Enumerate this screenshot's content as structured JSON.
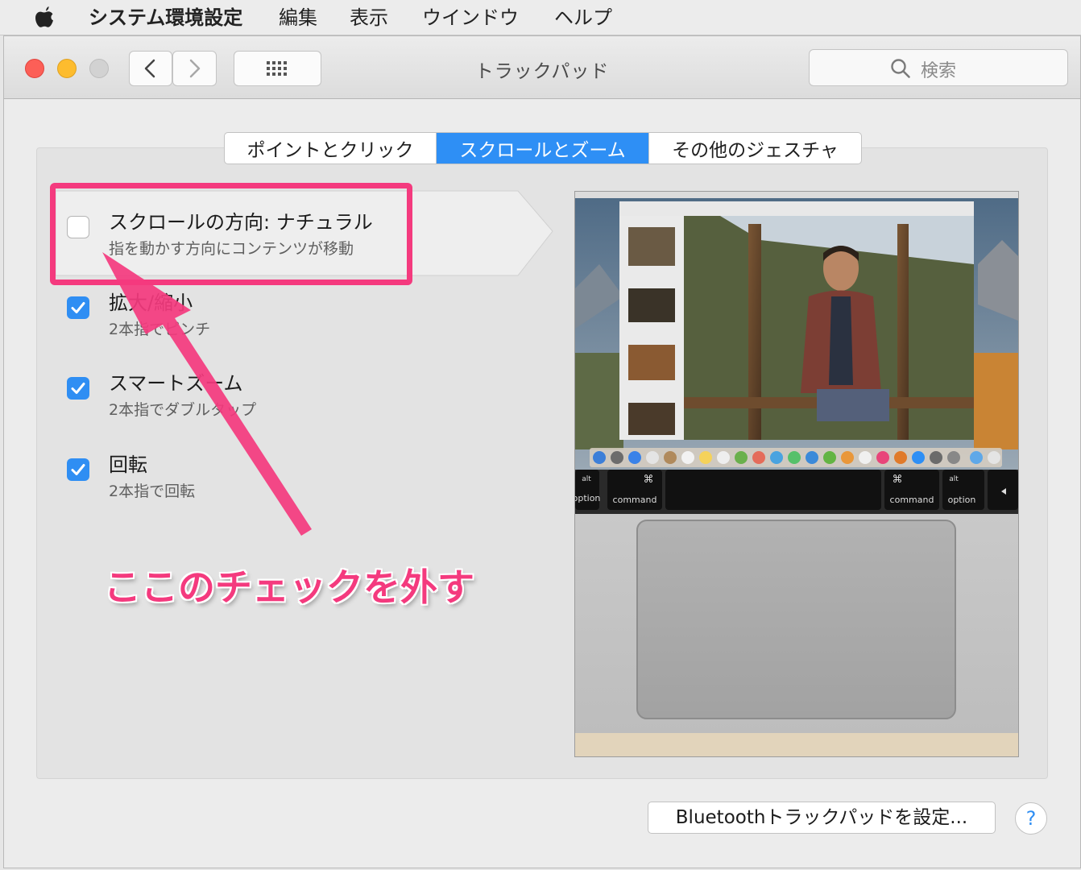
{
  "menubar": {
    "app_name": "システム環境設定",
    "items": [
      "編集",
      "表示",
      "ウインドウ",
      "ヘルプ"
    ]
  },
  "window": {
    "title": "トラックパッド",
    "search_placeholder": "検索"
  },
  "tabs": [
    {
      "label": "ポイントとクリック",
      "active": false
    },
    {
      "label": "スクロールとズーム",
      "active": true
    },
    {
      "label": "その他のジェスチャ",
      "active": false
    }
  ],
  "options": [
    {
      "title": "スクロールの方向: ナチュラル",
      "subtitle": "指を動かす方向にコンテンツが移動",
      "checked": false
    },
    {
      "title": "拡大/縮小",
      "subtitle": "2本指でピンチ",
      "checked": true
    },
    {
      "title": "スマートズーム",
      "subtitle": "2本指でダブルタップ",
      "checked": true
    },
    {
      "title": "回転",
      "subtitle": "2本指で回転",
      "checked": true
    }
  ],
  "preview": {
    "keys": [
      "option",
      "command",
      "command",
      "option"
    ],
    "key_alt": "alt",
    "key_cmd_symbol": "⌘"
  },
  "annotation": "ここのチェックを外す",
  "footer": {
    "bluetooth_button": "Bluetoothトラックパッドを設定...",
    "help_label": "?"
  },
  "colors": {
    "accent": "#2e8ff5",
    "annotation": "#f43a7e"
  }
}
